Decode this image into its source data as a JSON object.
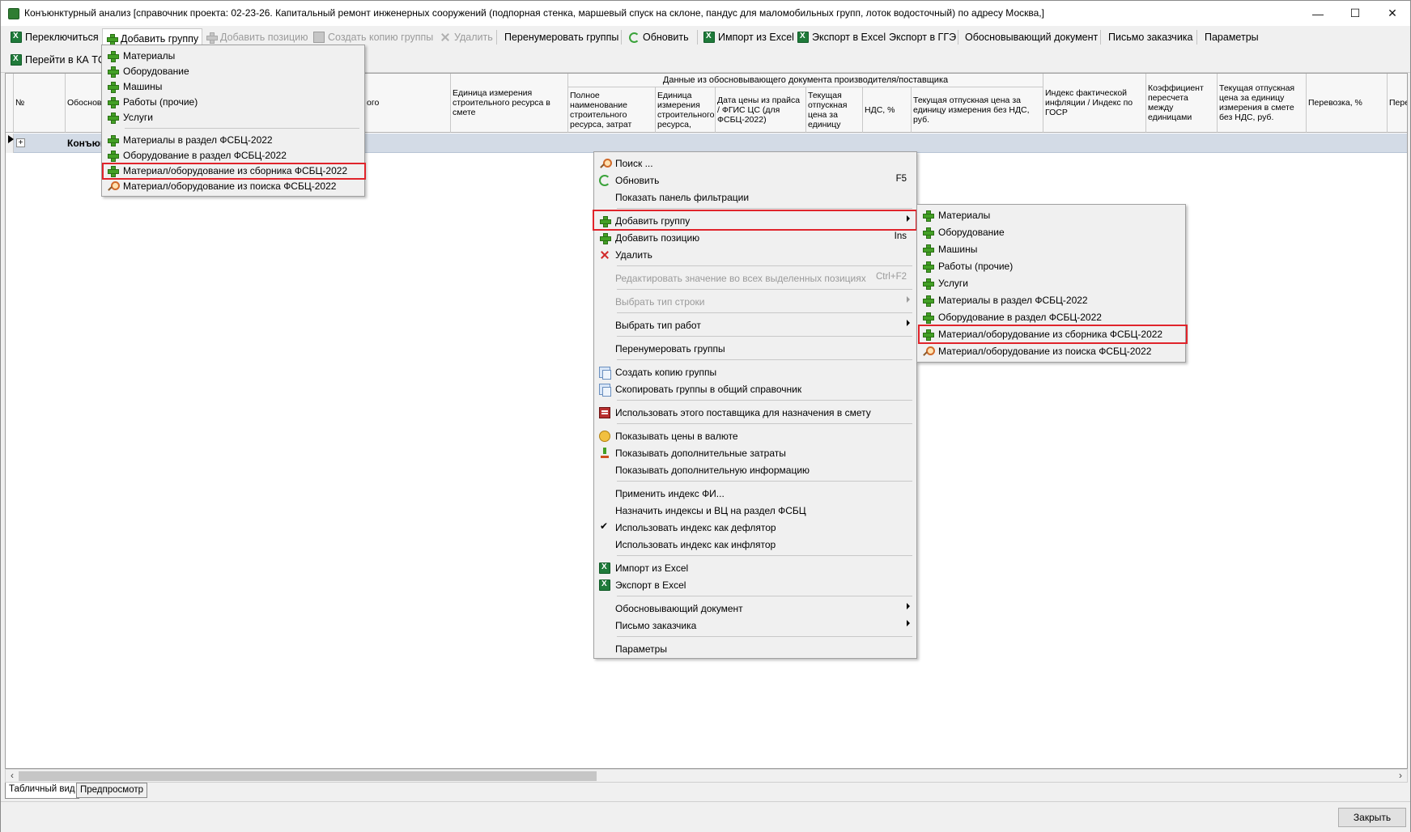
{
  "window": {
    "title": "Конъюнктурный анализ [справочник проекта: 02-23-26. Капитальный ремонт инженерных сооружений (подпорная стенка, маршевый спуск на склоне, пандус для маломобильных групп, лоток водосточный) по адресу Москва,]",
    "minimize": "—",
    "maximize": "☐",
    "close": "✕"
  },
  "toolbar": {
    "switch": "Переключиться",
    "add_group": "Добавить группу",
    "add_position": "Добавить позицию",
    "copy_group": "Создать копию группы",
    "delete": "Удалить",
    "renumber": "Перенумеровать группы",
    "refresh": "Обновить",
    "import_excel": "Импорт из Excel",
    "export_excel": "Экспорт в Excel",
    "export_gge": "Экспорт в ГГЭ",
    "justifying_doc": "Обосновывающий документ",
    "customer_letter": "Письмо заказчика",
    "params": "Параметры",
    "goto_ka": "Перейти в КА ТСН"
  },
  "grid": {
    "header_group": "Данные из обосновывающего документа производителя/поставщика",
    "col_num": "№",
    "col_justif": "Обосновани",
    "col_name_tail": "ого",
    "col_unit_smeta": "Единица измерения строительного ресурса в смете",
    "col_fullname": "Полное наименование строительного ресурса, затрат",
    "col_unit_res": "Единица измерения строительного ресурса,",
    "col_price_date": "Дата цены из прайса / ФГИС ЦС (для ФСБЦ-2022)",
    "col_current_price": "Текущая отпускная цена за единицу",
    "col_vat": "НДС, %",
    "col_price_novat": "Текущая отпускная цена за единицу измерения без НДС, руб.",
    "col_inflation": "Индекс фактической инфляции / Индекс по ГОСР",
    "col_coef": "Коэффициент пересчета между единицами",
    "col_smeta_price": "Текущая отпускная цена за единицу измерения в смете без НДС, руб.",
    "col_transport": "Перевозка, %",
    "col_pere": "Пере",
    "group_row_label": "Конъюн",
    "expander": "+"
  },
  "toolbar_dropdown": {
    "items": [
      "Материалы",
      "Оборудование",
      "Машины",
      "Работы (прочие)",
      "Услуги",
      "Материалы в раздел ФСБЦ-2022",
      "Оборудование в раздел ФСБЦ-2022",
      "Материал/оборудование из сборника ФСБЦ-2022",
      "Материал/оборудование из поиска ФСБЦ-2022"
    ]
  },
  "context_menu": {
    "search": "Поиск ...",
    "refresh": "Обновить",
    "refresh_sc": "F5",
    "show_filter": "Показать панель фильтрации",
    "add_group": "Добавить группу",
    "add_position": "Добавить позицию",
    "add_position_sc": "Ins",
    "delete": "Удалить",
    "edit_all": "Редактировать значение во всех выделенных позициях",
    "edit_all_sc": "Ctrl+F2",
    "select_row_type": "Выбрать тип строки",
    "select_work_type": "Выбрать тип работ",
    "renumber": "Перенумеровать группы",
    "copy_group": "Создать копию группы",
    "copy_to_common": "Скопировать группы в общий справочник",
    "use_supplier": "Использовать этого поставщика для назначения в смету",
    "show_currency": "Показывать цены в валюте",
    "show_add_costs": "Показывать дополнительные затраты",
    "show_add_info": "Показывать дополнительную информацию",
    "apply_index": "Применить индекс ФИ...",
    "assign_indexes": "Назначить индексы и ВЦ на раздел ФСБЦ",
    "use_deflator": "Использовать индекс как дефлятор",
    "use_inflator": "Использовать индекс как инфлятор",
    "import_excel": "Импорт из Excel",
    "export_excel": "Экспорт в Excel",
    "justifying_doc": "Обосновывающий документ",
    "customer_letter": "Письмо заказчика",
    "params": "Параметры"
  },
  "submenu": {
    "items": [
      "Материалы",
      "Оборудование",
      "Машины",
      "Работы (прочие)",
      "Услуги",
      "Материалы в раздел ФСБЦ-2022",
      "Оборудование в раздел ФСБЦ-2022",
      "Материал/оборудование из сборника ФСБЦ-2022",
      "Материал/оборудование из поиска ФСБЦ-2022"
    ]
  },
  "tabs": {
    "table_view": "Табличный вид",
    "preview": "Предпросмотр"
  },
  "footer": {
    "close": "Закрыть"
  },
  "colors": {
    "highlight": "#e0242b",
    "group_row": "#d3dbe6",
    "plus_icon": "#43a025"
  }
}
